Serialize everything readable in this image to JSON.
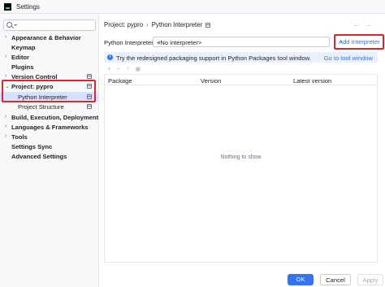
{
  "window": {
    "title": "Settings"
  },
  "sidebar": {
    "search_placeholder": "",
    "items": [
      {
        "label": "Appearance & Behavior",
        "expandable": true
      },
      {
        "label": "Keymap",
        "expandable": false
      },
      {
        "label": "Editor",
        "expandable": true
      },
      {
        "label": "Plugins",
        "expandable": false
      },
      {
        "label": "Version Control",
        "expandable": true
      },
      {
        "label": "Project: pypro",
        "expandable": true,
        "expanded": true
      },
      {
        "label": "Python Interpreter",
        "selected": true
      },
      {
        "label": "Project Structure"
      },
      {
        "label": "Build, Execution, Deployment",
        "expandable": true
      },
      {
        "label": "Languages & Frameworks",
        "expandable": true
      },
      {
        "label": "Tools",
        "expandable": true
      },
      {
        "label": "Settings Sync",
        "expandable": false
      },
      {
        "label": "Advanced Settings",
        "expandable": false
      }
    ]
  },
  "breadcrumb": {
    "parent": "Project: pypro",
    "separator": "›",
    "current": "Python Interpreter"
  },
  "interpreter": {
    "label": "Python Interpreter:",
    "value": "<No interpreter>",
    "add_label": "Add Interpreter"
  },
  "banner": {
    "text": "Try the redesigned packaging support in Python Packages tool window.",
    "link": "Go to tool window"
  },
  "table": {
    "columns": [
      "Package",
      "Version",
      "Latest version"
    ],
    "empty_text": "Nothing to show"
  },
  "footer": {
    "ok": "OK",
    "cancel": "Cancel",
    "apply": "Apply"
  },
  "colors": {
    "accent": "#3574f0",
    "selection": "#d4e2ff",
    "annotation": "#e0252b"
  }
}
